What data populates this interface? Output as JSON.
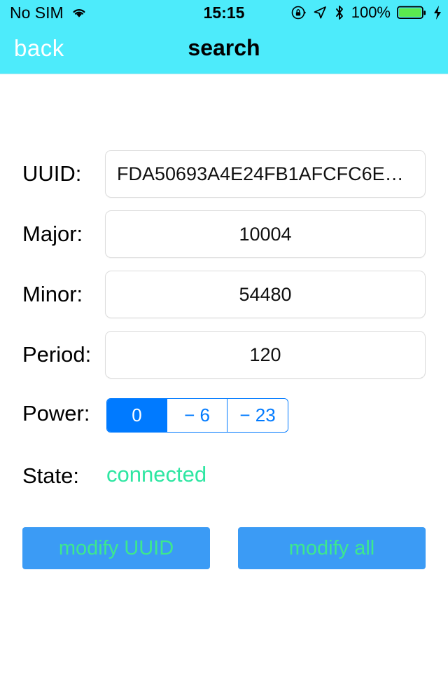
{
  "status_bar": {
    "carrier": "No SIM",
    "wifi_icon": "wifi-icon",
    "time": "15:15",
    "rotation_lock_icon": "rotation-lock-icon",
    "location_icon": "location-arrow-icon",
    "bluetooth_icon": "bluetooth-icon",
    "battery_percent": "100%",
    "battery_icon": "battery-full-icon",
    "charging_icon": "lightning-bolt-icon",
    "background_color": "#4DEBFB",
    "battery_fill_color": "#5BE84F"
  },
  "nav_bar": {
    "back_label": "back",
    "title": "search",
    "background_color": "#4DEBFB",
    "back_color": "#FFFFFF",
    "title_color": "#000000"
  },
  "form": {
    "rows": [
      {
        "label": "UUID:",
        "value": "FDA50693A4E24FB1AFCFC6E…"
      },
      {
        "label": "Major:",
        "value": "10004"
      },
      {
        "label": "Minor:",
        "value": "54480"
      },
      {
        "label": "Period:",
        "value": "120"
      }
    ],
    "power": {
      "label": "Power:",
      "options": [
        "0",
        "− 6",
        "− 23"
      ],
      "selected_index": 0,
      "accent_color": "#007AFF"
    },
    "state": {
      "label": "State:",
      "value": "connected",
      "value_color": "#2EE6A2"
    }
  },
  "actions": {
    "buttons": [
      {
        "label": "modify UUID"
      },
      {
        "label": "modify all"
      }
    ],
    "background_color": "#3B9BF5",
    "text_color": "#3DE88E"
  }
}
